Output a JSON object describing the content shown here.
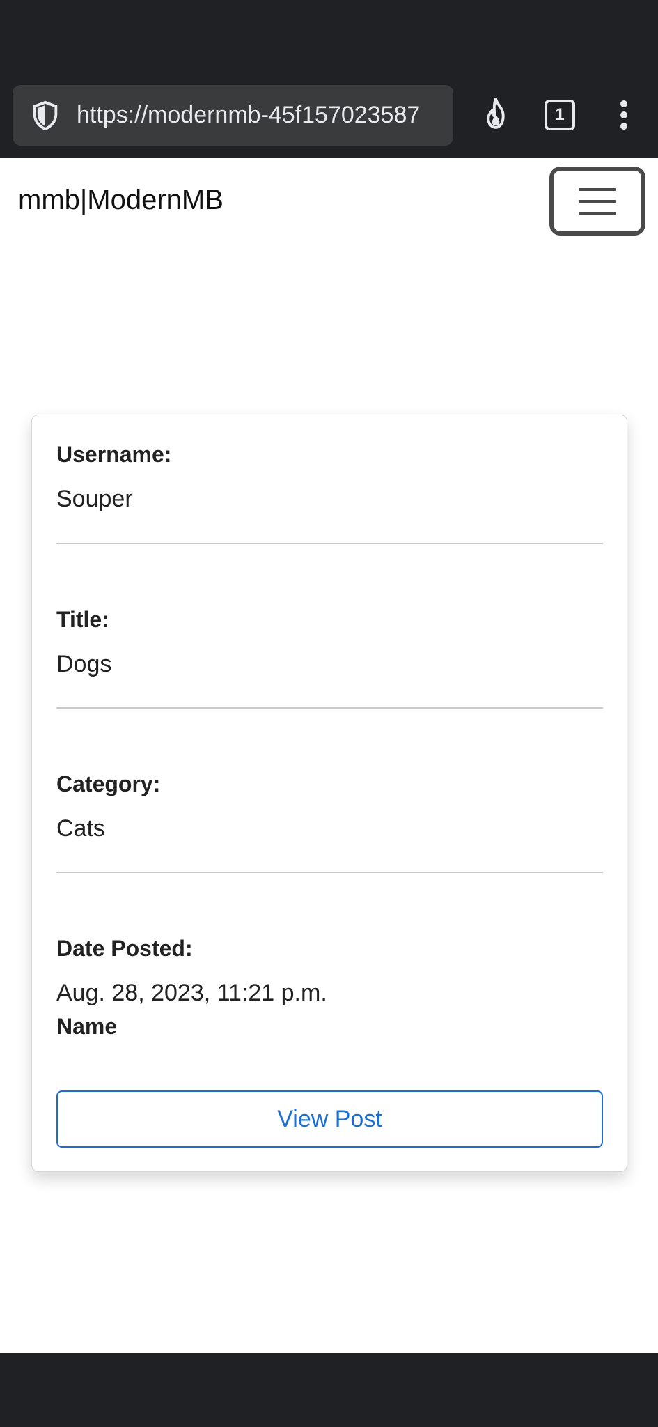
{
  "browser": {
    "url": "https://modernmb-45f157023587",
    "tab_count": "1"
  },
  "navbar": {
    "brand": "mmb|ModernMB"
  },
  "post": {
    "username_label": "Username:",
    "username": "Souper",
    "title_label": "Title:",
    "title": "Dogs",
    "category_label": "Category:",
    "category": "Cats",
    "date_label": "Date Posted:",
    "date": "Aug. 28, 2023, 11:21 p.m.",
    "name_label": "Name",
    "view_button": "View Post"
  },
  "colors": {
    "chrome": "#202124",
    "url_box": "#3a3b3d",
    "accent": "#1c6fd1"
  }
}
